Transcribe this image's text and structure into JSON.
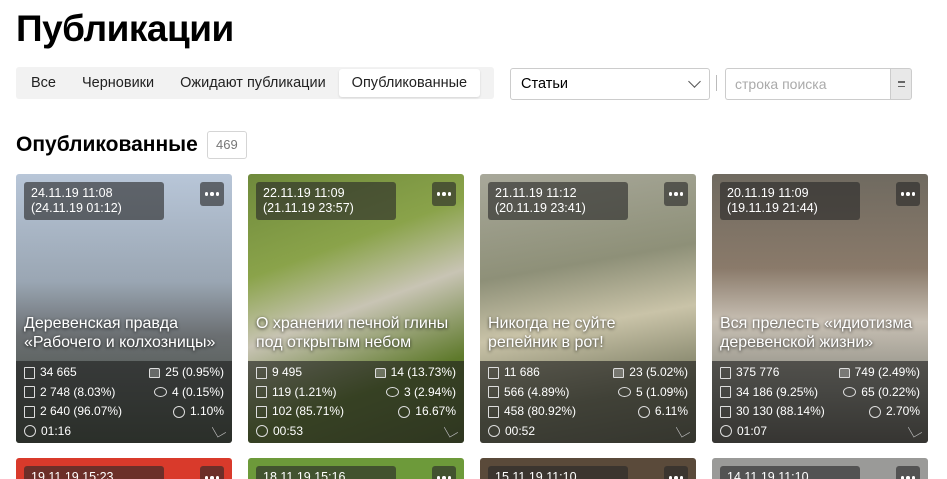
{
  "page": {
    "title": "Публикации"
  },
  "tabs": [
    {
      "label": "Все"
    },
    {
      "label": "Черновики"
    },
    {
      "label": "Ожидают публикации"
    },
    {
      "label": "Опубликованные"
    }
  ],
  "filter": {
    "selected": "Статьи"
  },
  "search": {
    "placeholder": "строка поиска"
  },
  "section": {
    "title": "Опубликованные",
    "count": "469"
  },
  "cards": [
    {
      "date1": "24.11.19 11:08",
      "date2": "(24.11.19 01:12)",
      "title": "Деревенская правда «Рабочего и колхозницы»",
      "views": "34 665",
      "likes": "25 (0.95%)",
      "reads": "2 748 (8.03%)",
      "comments": "4 (0.15%)",
      "finished": "2 640 (96.07%)",
      "engagement": "1.10%",
      "time": "01:16"
    },
    {
      "date1": "22.11.19 11:09",
      "date2": "(21.11.19 23:57)",
      "title": "О хранении печной глины под открытым небом",
      "views": "9 495",
      "likes": "14 (13.73%)",
      "reads": "119 (1.21%)",
      "comments": "3 (2.94%)",
      "finished": "102 (85.71%)",
      "engagement": "16.67%",
      "time": "00:53"
    },
    {
      "date1": "21.11.19 11:12",
      "date2": "(20.11.19 23:41)",
      "title": "Никогда не суйте репейник в рот!",
      "views": "11 686",
      "likes": "23 (5.02%)",
      "reads": "566 (4.89%)",
      "comments": "5 (1.09%)",
      "finished": "458 (80.92%)",
      "engagement": "6.11%",
      "time": "00:52"
    },
    {
      "date1": "20.11.19 11:09",
      "date2": "(19.11.19 21:44)",
      "title": "Вся прелесть «идиотизма деревенской жизни»",
      "views": "375 776",
      "likes": "749 (2.49%)",
      "reads": "34 186 (9.25%)",
      "comments": "65 (0.22%)",
      "finished": "30 130 (88.14%)",
      "engagement": "2.70%",
      "time": "01:07"
    }
  ],
  "cards_next": [
    {
      "date1": "19.11.19 15:23"
    },
    {
      "date1": "18.11.19 15:16"
    },
    {
      "date1": "15.11.19 11:10"
    },
    {
      "date1": "14.11.19 11:10"
    }
  ]
}
